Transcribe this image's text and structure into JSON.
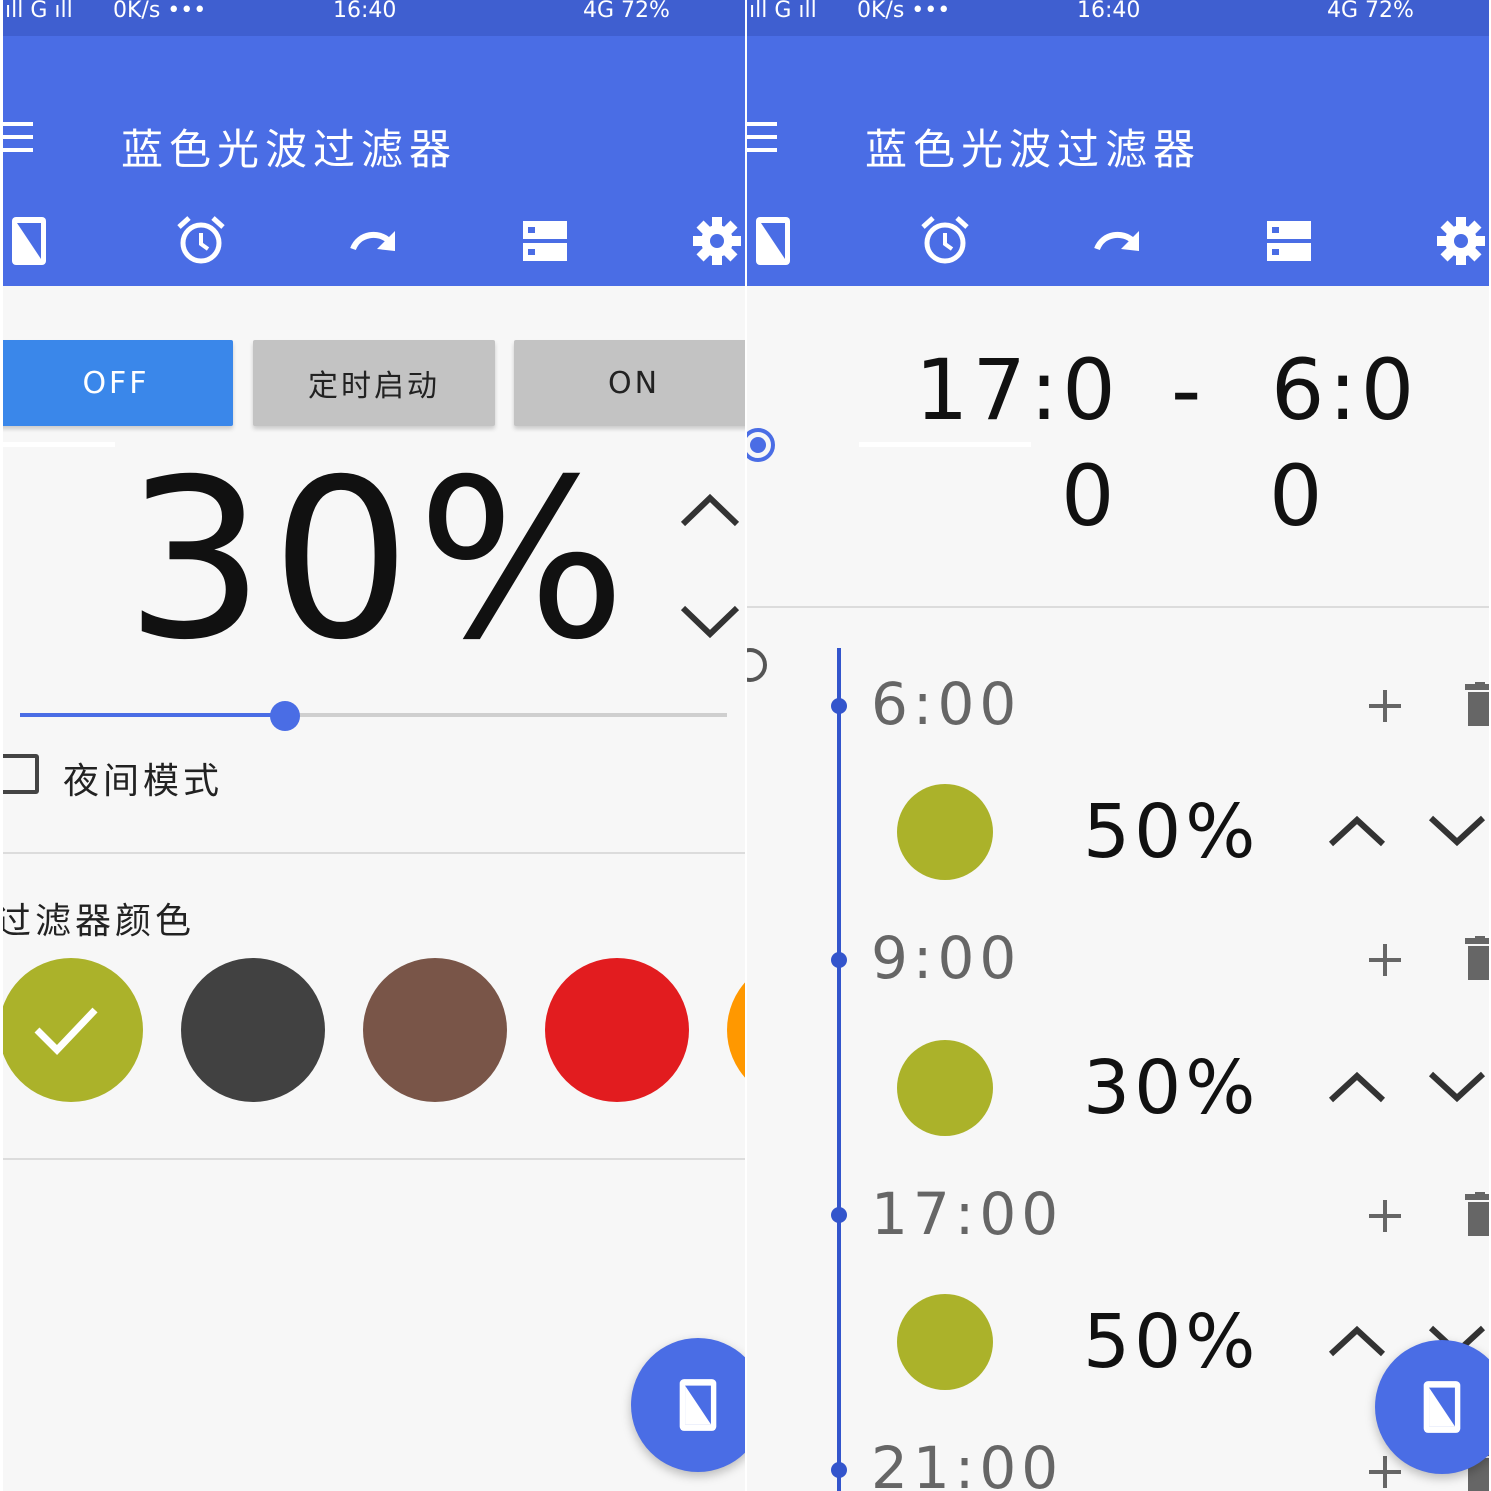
{
  "status_bar": {
    "signal": "ıll G ıll",
    "speed": "0K/s •••",
    "time": "16:40",
    "battery": "4G 72%"
  },
  "app": {
    "title": "蓝色光波过滤器"
  },
  "tabs": [
    {
      "icon": "phone-filter-icon"
    },
    {
      "icon": "alarm-icon"
    },
    {
      "icon": "redo-icon"
    },
    {
      "icon": "storage-icon"
    },
    {
      "icon": "gear-icon"
    }
  ],
  "left": {
    "active_tab_index": 0,
    "mode_buttons": {
      "off": "OFF",
      "timed": "定时启动",
      "on": "ON"
    },
    "active_mode": "off",
    "intensity": "30%",
    "slider_value": 0.375,
    "night_mode_label": "夜间模式",
    "night_mode_checked": false,
    "filter_color_title": "过滤器颜色",
    "swatches": [
      {
        "color": "#abb22a",
        "selected": true
      },
      {
        "color": "#414141",
        "selected": false
      },
      {
        "color": "#795548",
        "selected": false
      },
      {
        "color": "#e21c1f",
        "selected": false
      },
      {
        "color": "#ff9800",
        "selected": false
      }
    ]
  },
  "right": {
    "active_tab_index": 1,
    "range": {
      "start_main": "17:0",
      "start_tail": "0",
      "dash": "-",
      "end_main": "6:0",
      "end_tail": "0"
    },
    "schedule": [
      {
        "time": "6:00",
        "color": "#abb22a",
        "percent": "50%"
      },
      {
        "time": "9:00",
        "color": "#abb22a",
        "percent": "30%"
      },
      {
        "time": "17:00",
        "color": "#abb22a",
        "percent": "50%"
      },
      {
        "time": "21:00"
      }
    ]
  },
  "colors": {
    "primary": "#4a6de5",
    "status_bar": "#3f5fd0",
    "active_button": "#3a87ea",
    "inactive_button": "#c3c3c3"
  }
}
